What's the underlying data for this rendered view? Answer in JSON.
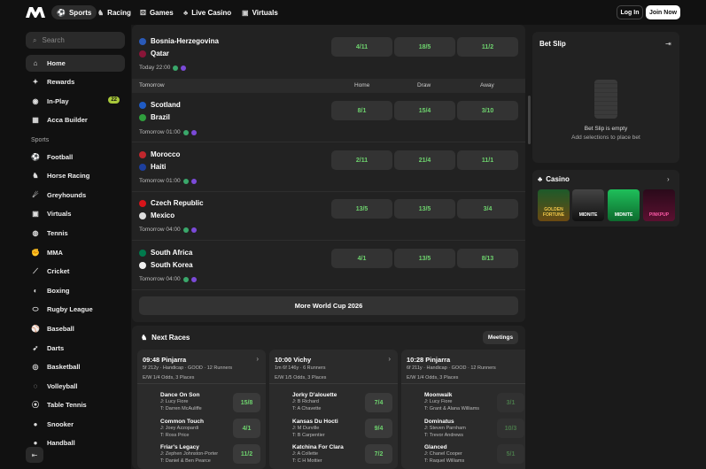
{
  "header": {
    "nav": [
      {
        "label": "Sports",
        "icon": "sports-icon",
        "active": true
      },
      {
        "label": "Racing",
        "icon": "racing-icon"
      },
      {
        "label": "Games",
        "icon": "games-icon"
      },
      {
        "label": "Live Casino",
        "icon": "live-casino-icon"
      },
      {
        "label": "Virtuals",
        "icon": "virtuals-icon"
      }
    ],
    "login_label": "Log In",
    "join_label": "Join Now"
  },
  "sidebar": {
    "search_placeholder": "Search",
    "main_items": [
      {
        "label": "Home",
        "icon": "home-icon",
        "active": true
      },
      {
        "label": "Rewards",
        "icon": "rewards-icon"
      },
      {
        "label": "In-Play",
        "icon": "in-play-icon",
        "badge": "22"
      },
      {
        "label": "Acca Builder",
        "icon": "acca-icon"
      }
    ],
    "sports_label": "Sports",
    "sports": [
      {
        "label": "Football"
      },
      {
        "label": "Horse Racing"
      },
      {
        "label": "Greyhounds"
      },
      {
        "label": "Virtuals"
      },
      {
        "label": "Tennis"
      },
      {
        "label": "MMA"
      },
      {
        "label": "Cricket"
      },
      {
        "label": "Boxing"
      },
      {
        "label": "Rugby League"
      },
      {
        "label": "Baseball"
      },
      {
        "label": "Darts"
      },
      {
        "label": "Basketball"
      },
      {
        "label": "Volleyball"
      },
      {
        "label": "Table Tennis"
      },
      {
        "label": "Snooker"
      },
      {
        "label": "Handball"
      }
    ]
  },
  "matches": {
    "first": {
      "home": "Bosnia-Herzegovina",
      "away": "Qatar",
      "time": "Today 22:00",
      "odds": [
        "4/11",
        "18/5",
        "11/2"
      ]
    },
    "header": {
      "group": "Tomorrow",
      "home": "Home",
      "draw": "Draw",
      "away": "Away"
    },
    "list": [
      {
        "home": "Scotland",
        "away": "Brazil",
        "time": "Tomorrow 01:00",
        "odds": [
          "8/1",
          "15/4",
          "3/10"
        ]
      },
      {
        "home": "Morocco",
        "away": "Haiti",
        "time": "Tomorrow 01:00",
        "odds": [
          "2/11",
          "21/4",
          "11/1"
        ]
      },
      {
        "home": "Czech Republic",
        "away": "Mexico",
        "time": "Tomorrow 04:00",
        "odds": [
          "13/5",
          "13/5",
          "3/4"
        ]
      },
      {
        "home": "South Africa",
        "away": "South Korea",
        "time": "Tomorrow 04:00",
        "odds": [
          "4/1",
          "13/5",
          "8/13"
        ]
      }
    ],
    "more_label": "More World Cup 2026"
  },
  "races": {
    "title": "Next Races",
    "meetings_label": "Meetings",
    "cards": [
      {
        "title": "09:48 Pinjarra",
        "sub": "5f 212y · Handicap · GOOD · 12 Runners",
        "ew": "E/W 1/4 Odds, 3 Places",
        "runners": [
          {
            "name": "Dance On Son",
            "j": "J: Lucy Fiore",
            "t": "T: Darren McAuliffe",
            "odd": "15/8"
          },
          {
            "name": "Common Touch",
            "j": "J: Joey Azzopardi",
            "t": "T: Ross Price",
            "odd": "4/1"
          },
          {
            "name": "Friar's Legacy",
            "j": "J: Zephen Johnston-Porter",
            "t": "T: Daniel & Ben Pearce",
            "odd": "11/2"
          }
        ]
      },
      {
        "title": "10:00 Vichy",
        "sub": "1m 6f 146y · 6 Runners",
        "ew": "E/W 1/5 Odds, 3 Places",
        "runners": [
          {
            "name": "Jorky D'alouette",
            "j": "J: B Richard",
            "t": "T: A Chavette",
            "odd": "7/4"
          },
          {
            "name": "Kansas Du Hocti",
            "j": "J: M Durville",
            "t": "T: B Carpentier",
            "odd": "9/4"
          },
          {
            "name": "Katchina For Clara",
            "j": "J: A Collette",
            "t": "T: C H Mottier",
            "odd": "7/2"
          }
        ]
      },
      {
        "title": "10:28 Pinjarra",
        "sub": "6f 211y · Handicap · GOOD · 12 Runners",
        "ew": "E/W 1/4 Odds, 3 Places",
        "runners": [
          {
            "name": "Moonwalk",
            "j": "J: Lucy Fiore",
            "t": "T: Grant & Alana Williams",
            "odd": "3/1"
          },
          {
            "name": "Dominatus",
            "j": "J: Steven Parnham",
            "t": "T: Trevor Andrews",
            "odd": "10/3"
          },
          {
            "name": "Glanced",
            "j": "J: Chanel Cooper",
            "t": "T: Raquel Williams",
            "odd": "5/1"
          }
        ]
      }
    ]
  },
  "betslip": {
    "title": "Bet Slip",
    "empty": "Bet Slip is empty",
    "sub": "Add selections to place bet"
  },
  "casino": {
    "title": "Casino",
    "games": [
      "GOLDEN FORTUNE",
      "MIDNITE",
      "MIDNITE",
      "PINKPUP"
    ]
  }
}
